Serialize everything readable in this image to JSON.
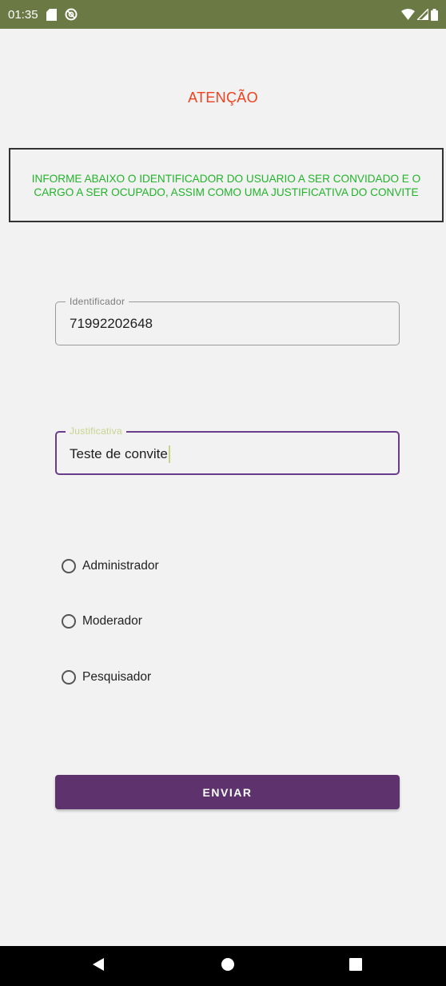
{
  "status_bar": {
    "time": "01:35",
    "icons": [
      "sd-card-icon",
      "sync-icon",
      "wifi-icon",
      "signal-icon",
      "battery-icon"
    ]
  },
  "header": {
    "title": "ATENÇÃO"
  },
  "info": {
    "message": "INFORME ABAIXO O IDENTIFICADOR DO USUARIO A SER CONVIDADO E O CARGO A SER OCUPADO, ASSIM COMO UMA JUSTIFICATIVA DO CONVITE"
  },
  "form": {
    "identificador": {
      "label": "Identificador",
      "value": "71992202648"
    },
    "justificativa": {
      "label": "Justificativa",
      "value": "Teste de convite"
    },
    "roles": [
      {
        "label": "Administrador",
        "selected": false
      },
      {
        "label": "Moderador",
        "selected": false
      },
      {
        "label": "Pesquisador",
        "selected": false
      }
    ],
    "submit_label": "ENVIAR"
  },
  "nav_bar": {
    "icons": [
      "back-icon",
      "home-icon",
      "recents-icon"
    ]
  },
  "colors": {
    "status_bar": "#6b7a44",
    "title": "#f0401e",
    "info_text": "#22b42a",
    "focused_border": "#6a3d8c",
    "button": "#5e336d",
    "background": "#f2f2f2"
  }
}
